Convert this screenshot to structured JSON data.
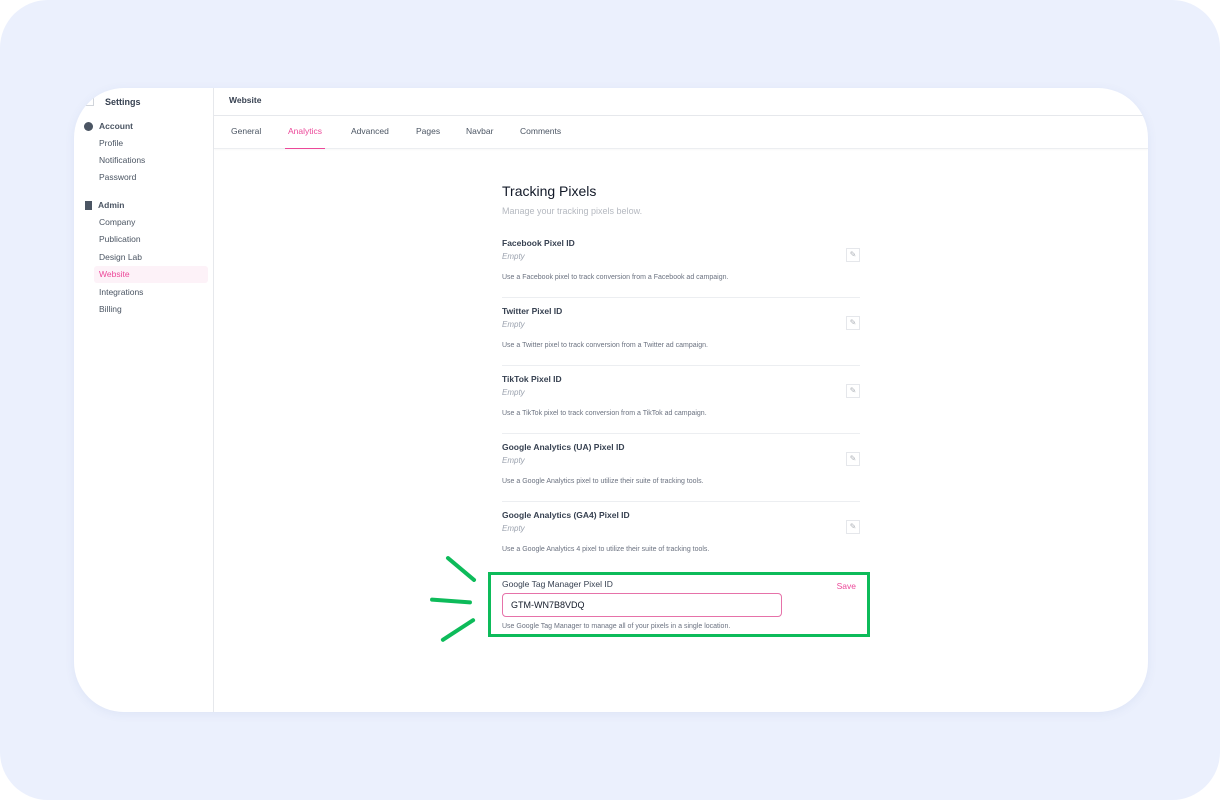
{
  "sidebar": {
    "title": "Settings",
    "groups": [
      {
        "label": "Account",
        "icon": "user-circle-icon",
        "items": [
          "Profile",
          "Notifications",
          "Password"
        ]
      },
      {
        "label": "Admin",
        "icon": "building-icon",
        "items": [
          "Company",
          "Publication",
          "Design Lab",
          "Website",
          "Integrations",
          "Billing"
        ]
      }
    ],
    "active": "Website"
  },
  "header": {
    "title": "Website"
  },
  "tabs": [
    "General",
    "Analytics",
    "Advanced",
    "Pages",
    "Navbar",
    "Comments"
  ],
  "active_tab": "Analytics",
  "main": {
    "title": "Tracking Pixels",
    "subtitle": "Manage your tracking pixels below.",
    "fields": [
      {
        "label": "Facebook Pixel ID",
        "value": "Empty",
        "desc": "Use a Facebook pixel to track conversion from a Facebook ad campaign."
      },
      {
        "label": "Twitter Pixel ID",
        "value": "Empty",
        "desc": "Use a Twitter pixel to track conversion from a Twitter ad campaign."
      },
      {
        "label": "TikTok Pixel ID",
        "value": "Empty",
        "desc": "Use a TikTok pixel to track conversion from a TikTok ad campaign."
      },
      {
        "label": "Google Analytics (UA) Pixel ID",
        "value": "Empty",
        "desc": "Use a Google Analytics pixel to utilize their suite of tracking tools."
      },
      {
        "label": "Google Analytics (GA4) Pixel ID",
        "value": "Empty",
        "desc": "Use a Google Analytics 4 pixel to utilize their suite of tracking tools."
      }
    ],
    "gtm": {
      "label": "Google Tag Manager Pixel ID",
      "value": "GTM-WN7B8VDQ",
      "save": "Save",
      "desc": "Use Google Tag Manager to manage all of your pixels in a single location."
    }
  },
  "colors": {
    "accent": "#ec4899",
    "highlight": "#0dbb5a",
    "background": "#ebf0fd"
  }
}
